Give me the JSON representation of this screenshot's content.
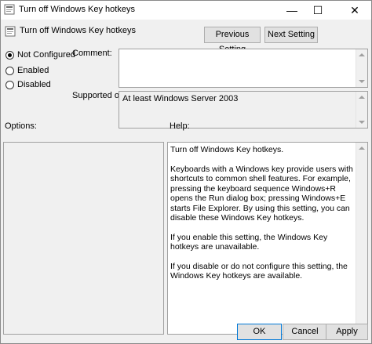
{
  "window": {
    "title": "Turn off Windows Key hotkeys",
    "minimize_glyph": "—",
    "maximize_glyph": "☐",
    "close_glyph": "✕"
  },
  "header": {
    "title": "Turn off Windows Key hotkeys",
    "icon": "policy-setting-icon"
  },
  "nav": {
    "previous_label": "Previous Setting",
    "next_label": "Next Setting"
  },
  "state": {
    "options": [
      {
        "label": "Not Configured",
        "checked": true
      },
      {
        "label": "Enabled",
        "checked": false
      },
      {
        "label": "Disabled",
        "checked": false
      }
    ]
  },
  "comment": {
    "label": "Comment:",
    "value": ""
  },
  "supported": {
    "label": "Supported on:",
    "value": "At least Windows Server 2003"
  },
  "options_panel": {
    "label": "Options:"
  },
  "help_panel": {
    "label": "Help:",
    "paragraphs": [
      "Turn off Windows Key hotkeys.",
      "Keyboards with a Windows key provide users with shortcuts to common shell features. For example, pressing the keyboard sequence Windows+R opens the Run dialog box; pressing Windows+E starts File Explorer. By using this setting, you can disable these Windows Key hotkeys.",
      "If you enable this setting, the Windows Key hotkeys are unavailable.",
      "If you disable or do not configure this setting, the Windows Key hotkeys are available."
    ]
  },
  "footer": {
    "ok_label": "OK",
    "cancel_label": "Cancel",
    "apply_label": "Apply"
  },
  "colors": {
    "dialog_bg": "#f0f0f0",
    "button_bg": "#e1e1e1",
    "default_button_border": "#0078d7",
    "field_border": "#a0a0a0"
  }
}
